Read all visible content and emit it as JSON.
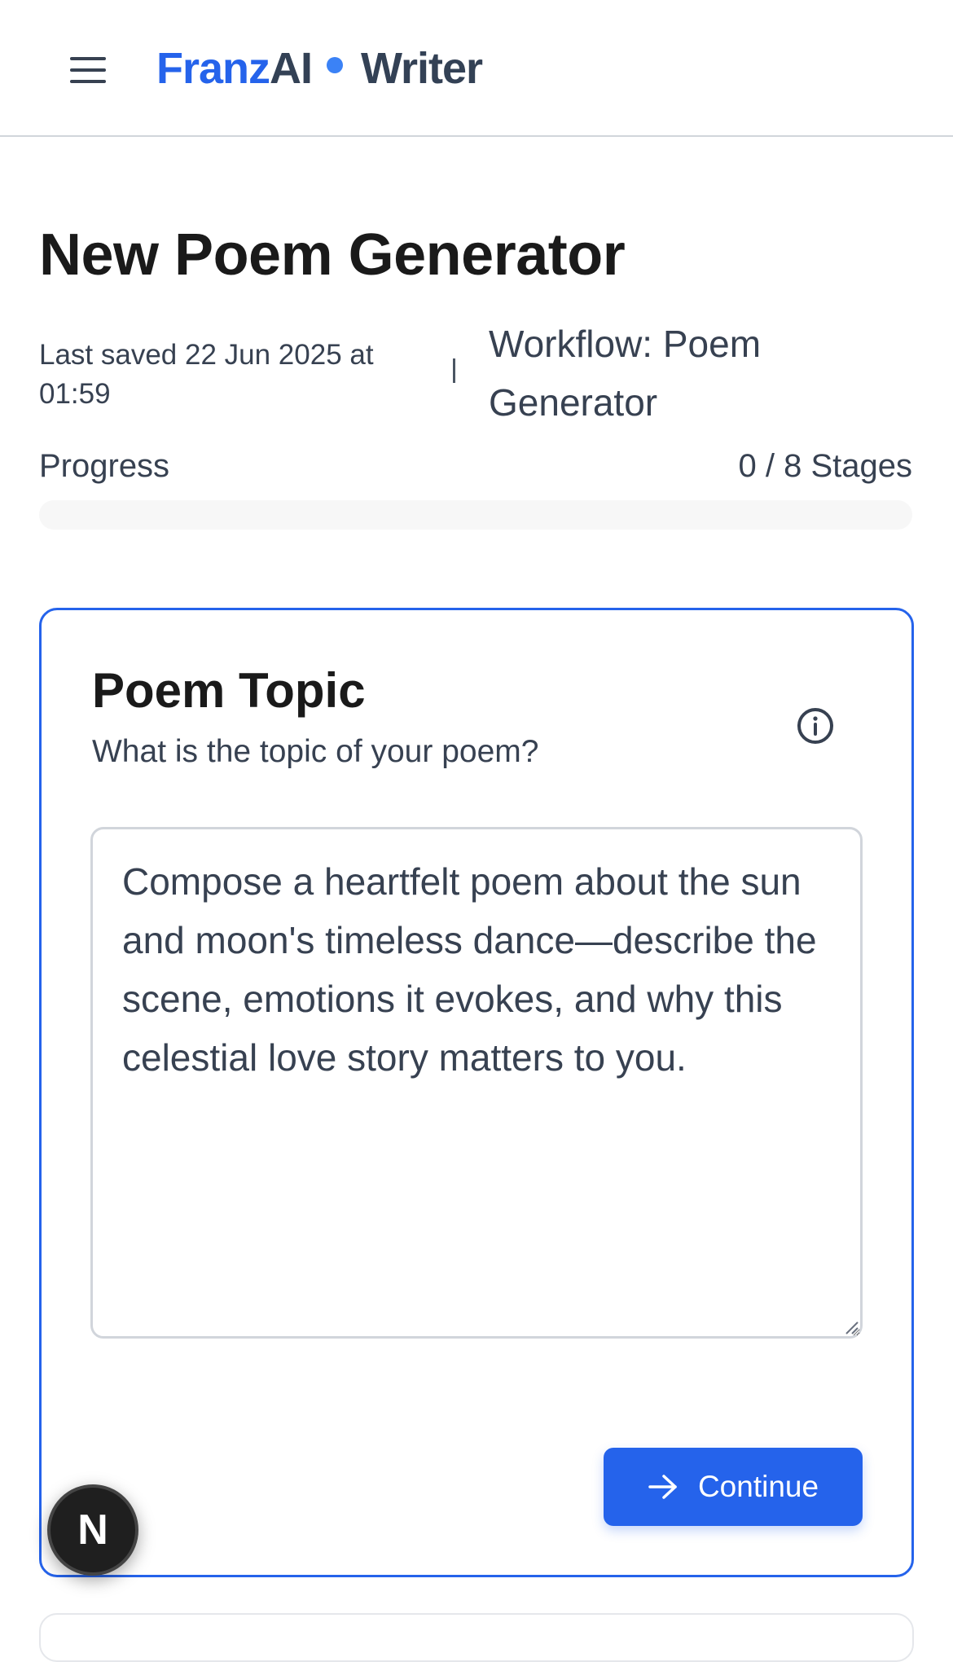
{
  "header": {
    "brand_part1": "Franz",
    "brand_part2": "AI",
    "brand_part3": "Writer",
    "brand_color": "#2563eb"
  },
  "page": {
    "title": "New Poem Generator",
    "last_saved": "Last saved 22 Jun 2025 at 01:59",
    "separator": "|",
    "workflow": "Workflow: Poem Generator"
  },
  "progress": {
    "label": "Progress",
    "count": "0 / 8 Stages",
    "completed": 0,
    "total": 8
  },
  "stage": {
    "title": "Poem Topic",
    "subtitle": "What is the topic of your poem?",
    "topic_value": "Compose a heartfelt poem about the sun and moon's timeless dance—describe the scene, emotions it evokes, and why this celestial love story matters to you.",
    "continue_label": "Continue"
  },
  "dev_badge": {
    "letter": "N"
  },
  "icons": {
    "menu": "hamburger-menu-icon",
    "info": "info-icon",
    "arrow": "arrow-right-icon"
  },
  "colors": {
    "accent": "#2563eb",
    "text": "#374151"
  }
}
